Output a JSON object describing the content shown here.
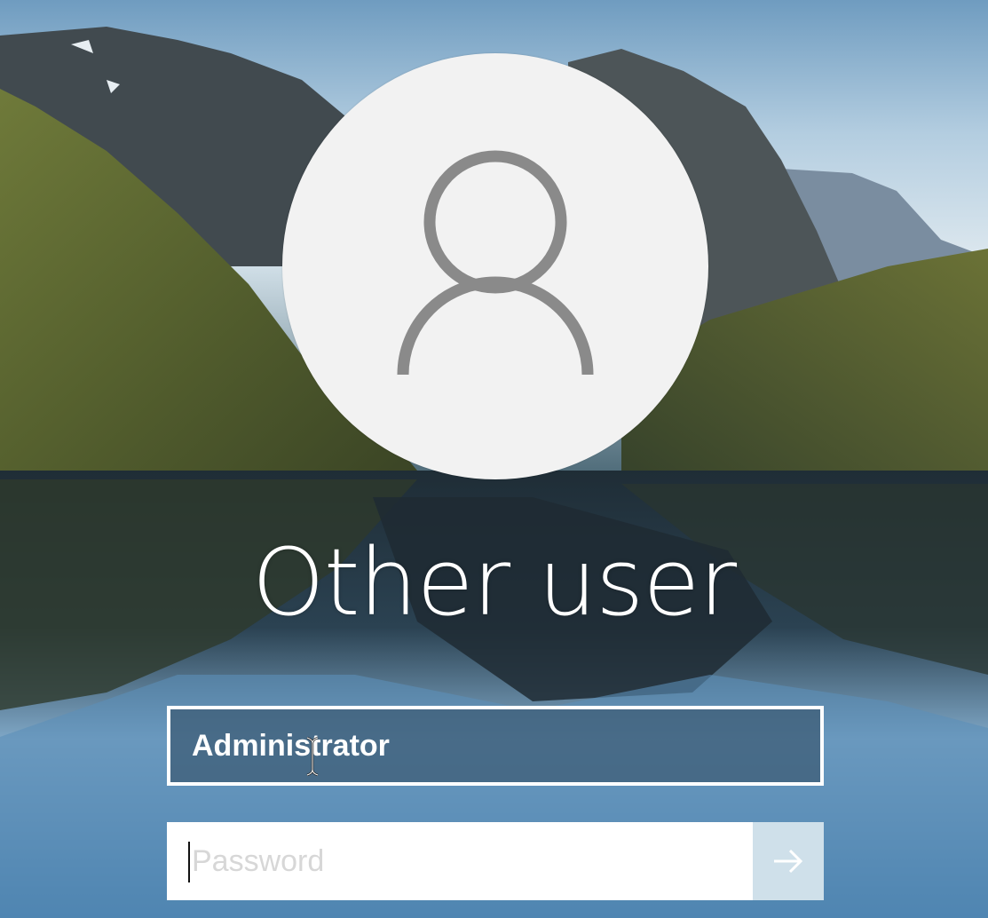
{
  "login": {
    "account_title": "Other user",
    "username_value": "Administrator",
    "password_placeholder": "Password"
  },
  "icons": {
    "avatar": "user-silhouette-icon",
    "submit": "arrow-right-icon"
  },
  "colors": {
    "avatar_bg": "#f2f2f2",
    "avatar_glyph": "#8a8a8a",
    "field_border": "#ffffff",
    "submit_bg": "#cfe0ea"
  }
}
